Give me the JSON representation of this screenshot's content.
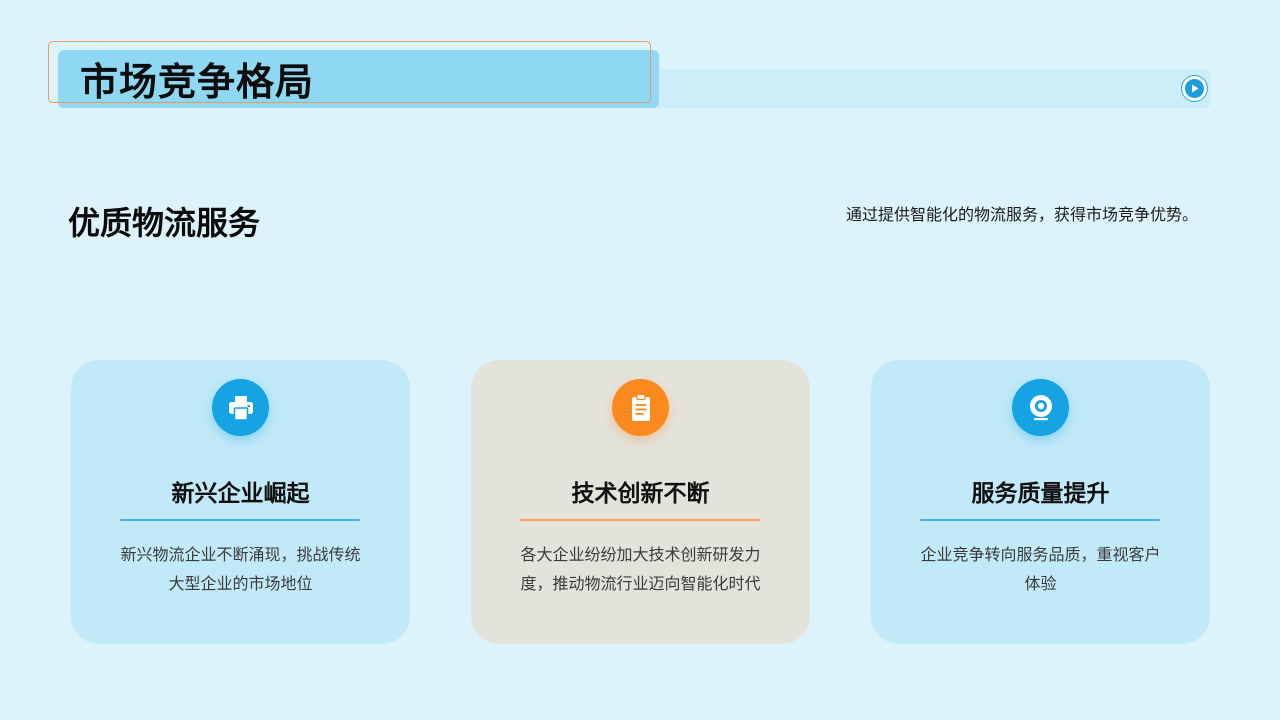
{
  "header": {
    "title": "市场竞争格局",
    "play_icon": "play-circle-icon"
  },
  "section": {
    "title": "优质物流服务",
    "description": "通过提供智能化的物流服务，获得市场竞争优势。"
  },
  "cards": [
    {
      "icon": "printer-icon",
      "title": "新兴企业崛起",
      "text": "新兴物流企业不断涌现，挑战传统大型企业的市场地位",
      "color": "#15a3e3"
    },
    {
      "icon": "clipboard-icon",
      "title": "技术创新不断",
      "text": "各大企业纷纷加大技术创新研发力度，推动物流行业迈向智能化时代",
      "color": "#fb8a1e"
    },
    {
      "icon": "webcam-icon",
      "title": "服务质量提升",
      "text": "企业竞争转向服务品质，重视客户体验",
      "color": "#15a3e3"
    }
  ],
  "colors": {
    "background": "#ddf3fb",
    "accent_blue": "#15a3e3",
    "accent_orange": "#fb8a1e",
    "title_outline": "#ee9a5a"
  }
}
